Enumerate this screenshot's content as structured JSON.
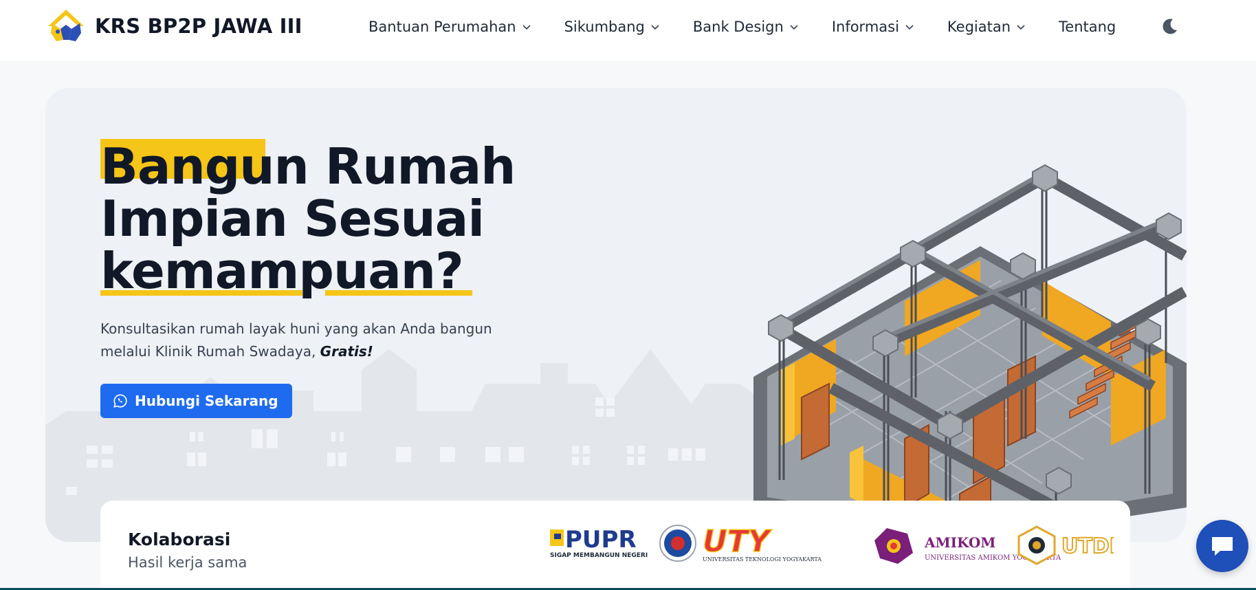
{
  "brand": {
    "title": "KRS BP2P JAWA III",
    "logo_icon": "house-hands-logo"
  },
  "nav": {
    "items": [
      {
        "label": "Bantuan Perumahan",
        "has_dropdown": true
      },
      {
        "label": "Sikumbang",
        "has_dropdown": true
      },
      {
        "label": "Bank Design",
        "has_dropdown": true
      },
      {
        "label": "Informasi",
        "has_dropdown": true
      },
      {
        "label": "Kegiatan",
        "has_dropdown": true
      },
      {
        "label": "Tentang",
        "has_dropdown": false
      }
    ],
    "theme_toggle_icon": "moon-icon"
  },
  "hero": {
    "title_line1": "Bangun Rumah",
    "title_line2": "Impian Sesuai",
    "title_line3": "kemampuan?",
    "desc": "Konsultasikan rumah layak huni yang akan Anda bangun melalui Klinik Rumah Swadaya,",
    "desc_emphasis": "Gratis!",
    "cta_label": "Hubungi Sekarang",
    "cta_icon": "whatsapp-icon"
  },
  "collab": {
    "title": "Kolaborasi",
    "subtitle": "Hasil kerja sama",
    "logos": [
      {
        "name": "PUPR",
        "caption": "SIGAP MEMBANGUN NEGERI"
      },
      {
        "name": "UTY",
        "caption": "UNIVERSITAS TEKNOLOGI YOGYAKARTA"
      },
      {
        "name": "AMIKOM",
        "caption": "UNIVERSITAS AMIKOM YOGYAKARTA"
      },
      {
        "name": "UTDI",
        "caption": ""
      }
    ]
  },
  "colors": {
    "accent_yellow": "#f5c518",
    "primary_blue": "#1e6bf0",
    "chat_blue": "#1f4fb8",
    "text_dark": "#111827"
  },
  "chat_icon": "chat-bubble-icon"
}
